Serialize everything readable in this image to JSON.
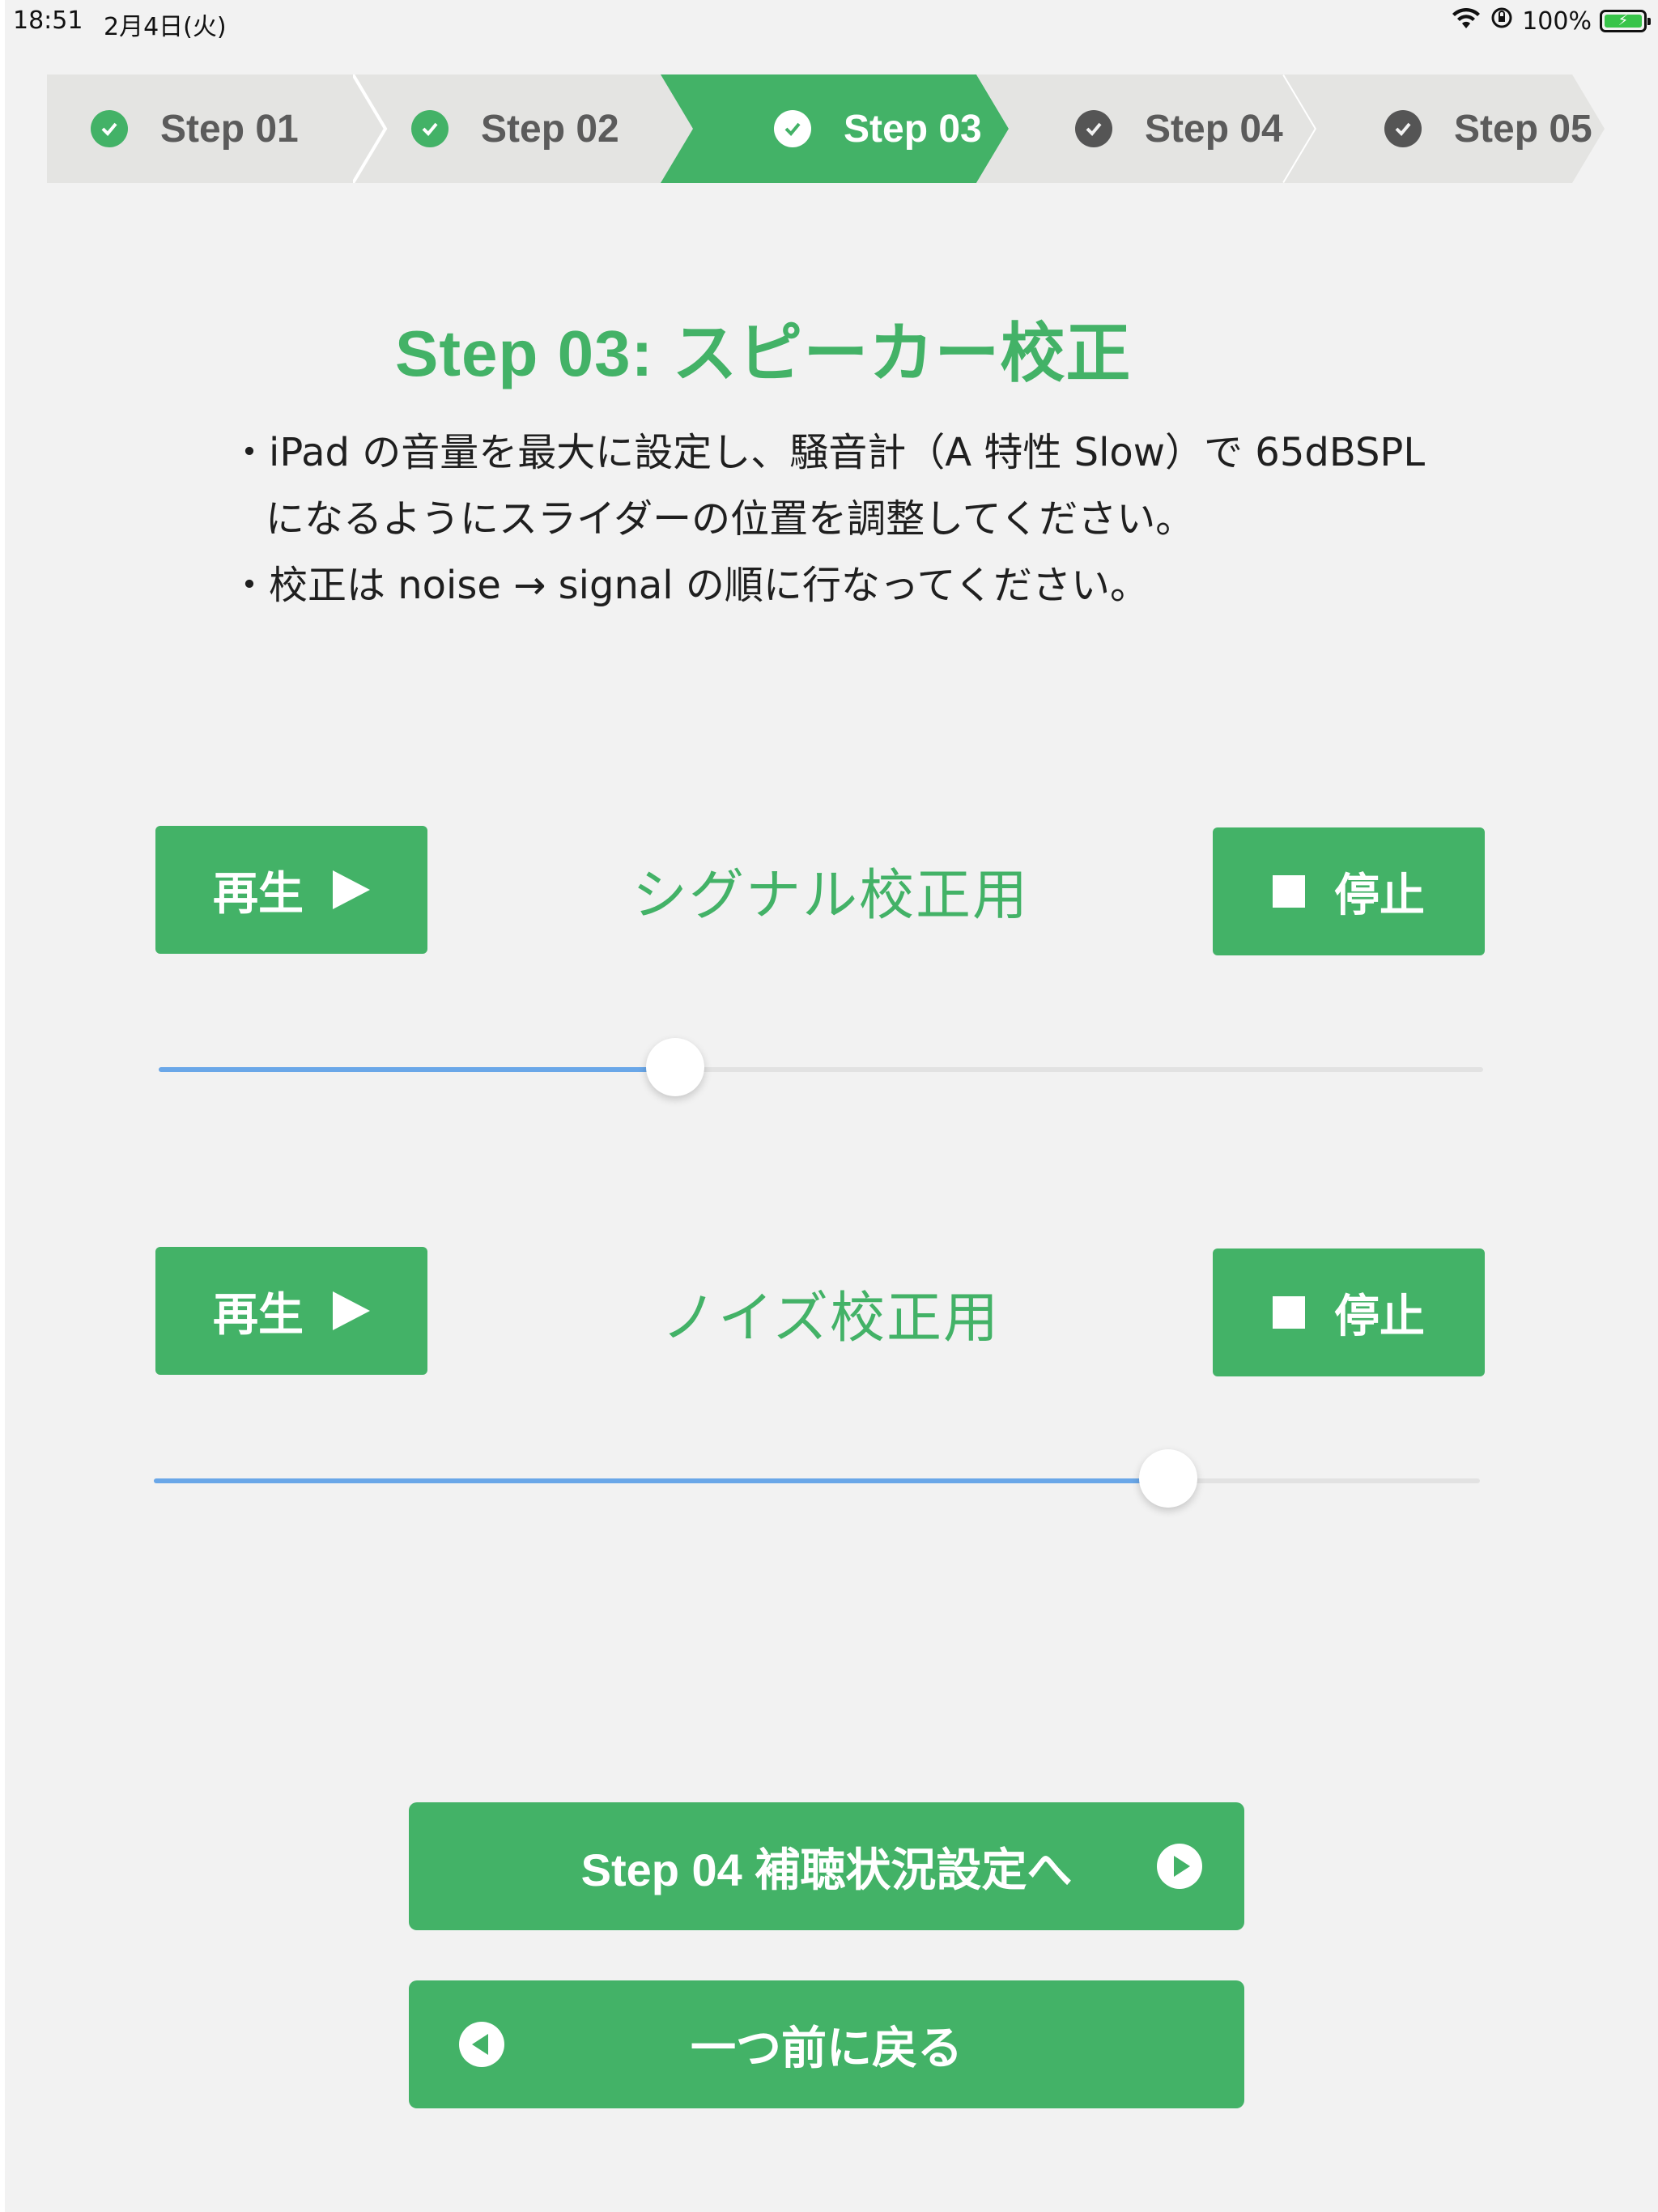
{
  "status_bar": {
    "time": "18:51",
    "date": "2月4日(火)",
    "battery_percent": "100%",
    "battery_level": 1.0
  },
  "stepper": {
    "current_index": 2,
    "steps": [
      {
        "label": "Step 01",
        "state": "done"
      },
      {
        "label": "Step 02",
        "state": "done"
      },
      {
        "label": "Step 03",
        "state": "current"
      },
      {
        "label": "Step 04",
        "state": "upcoming"
      },
      {
        "label": "Step 05",
        "state": "upcoming"
      }
    ]
  },
  "page": {
    "title": "Step 03: スピーカー校正",
    "instructions": [
      "・iPad の音量を最大に設定し、騒音計（A 特性 Slow）で 65dBSPL",
      "になるようにスライダーの位置を調整してください。",
      "・校正は noise → signal の順に行なってください。"
    ]
  },
  "signal_calibration": {
    "label": "シグナル校正用",
    "play_label": "再生",
    "stop_label": "停止",
    "slider_value": 0.39
  },
  "noise_calibration": {
    "label": "ノイズ校正用",
    "play_label": "再生",
    "stop_label": "停止",
    "slider_value": 0.765
  },
  "navigation": {
    "next_label": "Step 04 補聴状況設定へ",
    "back_label": "一つ前に戻る"
  },
  "colors": {
    "accent": "#43b267",
    "step_inactive_bg": "#e4e4e2",
    "step_done_text": "#5b5b5b",
    "step_upcoming_icon": "#555555",
    "slider_fill": "#6aa7e8",
    "background": "#f2f2f2"
  }
}
